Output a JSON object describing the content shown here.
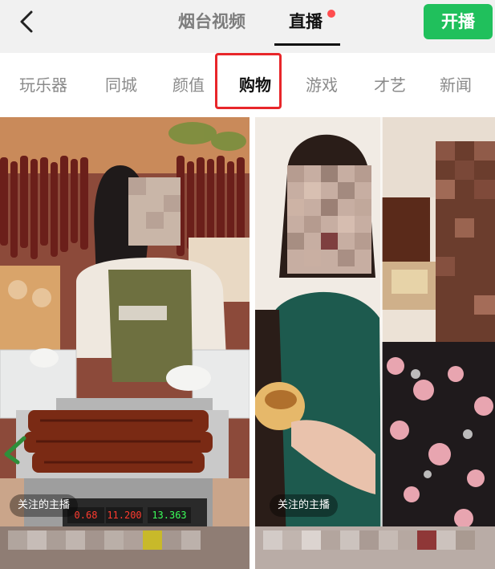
{
  "header": {
    "back_icon": "chevron-left-icon",
    "tabs": [
      {
        "label": "烟台视频",
        "active": false
      },
      {
        "label": "直播",
        "active": true
      }
    ],
    "live_dot_color": "#ff4d4f",
    "start_button_label": "开播",
    "start_button_color": "#20c05c"
  },
  "categories": {
    "items": [
      "玩乐器",
      "同城",
      "颜值",
      "购物",
      "游戏",
      "才艺",
      "新闻"
    ],
    "active": "购物",
    "highlight_color": "#e8262a"
  },
  "cards": [
    {
      "badge": "关注的主播",
      "scale_readouts": [
        "0.68",
        "11.200",
        "13.363"
      ]
    },
    {
      "badge": "关注的主播"
    }
  ]
}
